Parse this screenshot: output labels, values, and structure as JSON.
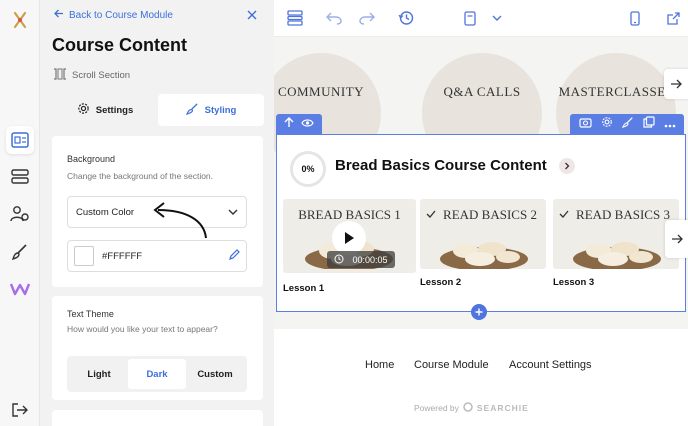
{
  "panel": {
    "back_label": "Back to Course Module",
    "title": "Course Content",
    "section_type": "Scroll Section",
    "tabs": [
      {
        "label": "Settings"
      },
      {
        "label": "Styling"
      }
    ],
    "background": {
      "label": "Background",
      "hint": "Change the background of the section.",
      "selected": "Custom Color",
      "color_value": "#FFFFFF"
    },
    "text_theme": {
      "label": "Text Theme",
      "hint": "How would you like your text to appear?",
      "options": [
        "Light",
        "Dark",
        "Custom"
      ],
      "selected": "Dark"
    }
  },
  "canvas": {
    "circles": [
      "COMMUNITY",
      "Q&A CALLS",
      "MASTERCLASSES"
    ],
    "section": {
      "progress": "0%",
      "title": "Bread Basics Course Content",
      "lessons": [
        {
          "thumb_title": "BREAD BASICS 1",
          "label": "Lesson 1",
          "duration": "00:00:05"
        },
        {
          "thumb_title": "READ BASICS 2",
          "label": "Lesson 2"
        },
        {
          "thumb_title": "READ BASICS 3",
          "label": "Lesson 3"
        }
      ]
    },
    "footer": {
      "links": [
        "Home",
        "Course Module",
        "Account Settings"
      ],
      "powered_by": "Powered by",
      "brand": "SEARCHIE"
    }
  },
  "colors": {
    "accent": "#3d6fd9",
    "selection": "#5b7ee5",
    "circle_bg": "#e8e4dd"
  }
}
